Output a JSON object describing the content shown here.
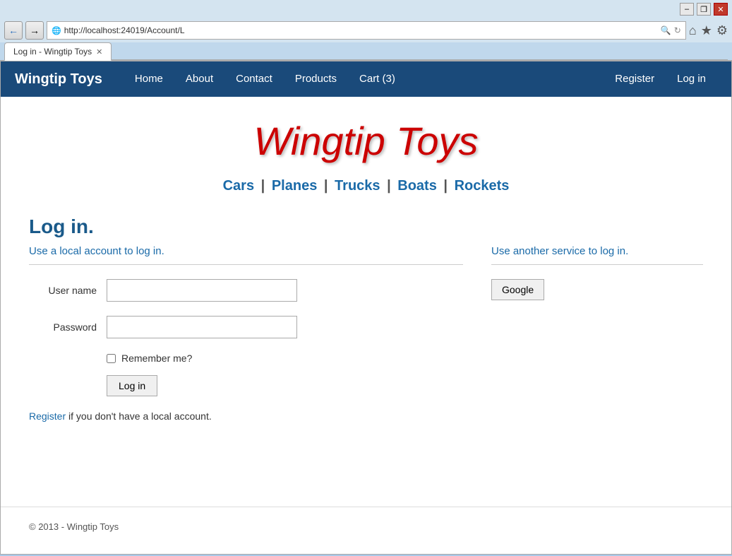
{
  "browser": {
    "title_bar": {
      "minimize": "–",
      "restore": "❐",
      "close": "✕"
    },
    "address": "http://localhost:24019/Account/L",
    "tab_label": "Log in - Wingtip Toys",
    "tab_close": "✕"
  },
  "nav_icons": {
    "home": "⌂",
    "star": "★",
    "gear": "⚙"
  },
  "navbar": {
    "brand": "Wingtip Toys",
    "links": [
      "Home",
      "About",
      "Contact",
      "Products",
      "Cart (3)"
    ],
    "right_links": [
      "Register",
      "Log in"
    ]
  },
  "site_title": "Wingtip Toys",
  "categories": {
    "items": [
      "Cars",
      "Planes",
      "Trucks",
      "Boats",
      "Rockets"
    ],
    "separator": "|"
  },
  "login": {
    "heading": "Log in.",
    "local_label": "Use a local account to log in.",
    "service_label": "Use another service to log in.",
    "username_label": "User name",
    "password_label": "Password",
    "remember_label": "Remember me?",
    "login_btn": "Log in",
    "google_btn": "Google",
    "register_text": " if you don't have a local account.",
    "register_link": "Register"
  },
  "footer": {
    "text": "© 2013 - Wingtip Toys"
  }
}
